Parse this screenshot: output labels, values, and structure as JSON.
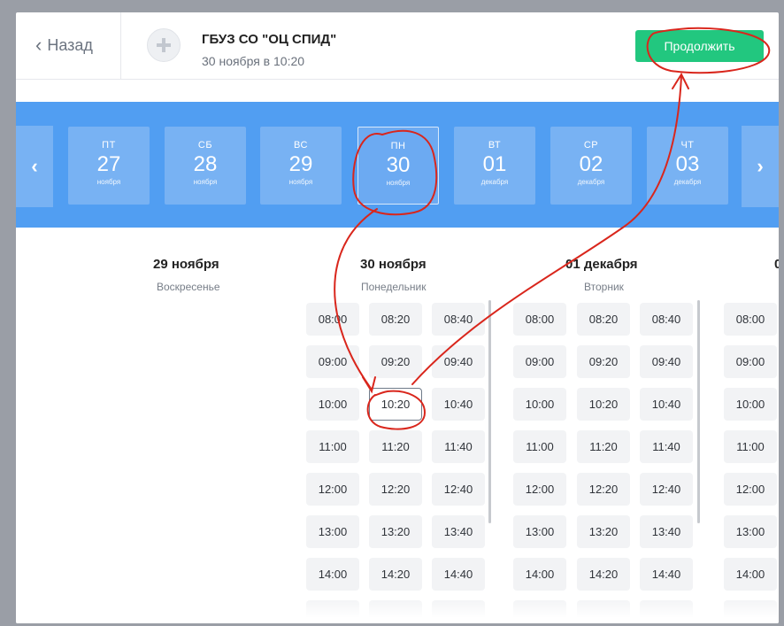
{
  "header": {
    "back_label": "Назад",
    "org_name": "ГБУЗ СО \"ОЦ СПИД\"",
    "appointment": "30 ноября в 10:20",
    "continue_label": "Продолжить"
  },
  "days": [
    {
      "dow": "ПТ",
      "num": "27",
      "month": "ноября"
    },
    {
      "dow": "СБ",
      "num": "28",
      "month": "ноября"
    },
    {
      "dow": "ВС",
      "num": "29",
      "month": "ноября"
    },
    {
      "dow": "ПН",
      "num": "30",
      "month": "ноября",
      "selected": true
    },
    {
      "dow": "ВТ",
      "num": "01",
      "month": "декабря"
    },
    {
      "dow": "СР",
      "num": "02",
      "month": "декабря"
    },
    {
      "dow": "ЧТ",
      "num": "03",
      "month": "декабря"
    }
  ],
  "schedule": [
    {
      "title": "29 ноября",
      "weekday": "Воскресенье",
      "slots": []
    },
    {
      "title": "30 ноября",
      "weekday": "Понедельник",
      "slots": [
        "08:00",
        "08:20",
        "08:40",
        "09:00",
        "09:20",
        "09:40",
        "10:00",
        "10:20",
        "10:40",
        "11:00",
        "11:20",
        "11:40",
        "12:00",
        "12:20",
        "12:40",
        "13:00",
        "13:20",
        "13:40",
        "14:00",
        "14:20",
        "14:40"
      ],
      "selected": "10:20"
    },
    {
      "title": "01 декабря",
      "weekday": "Вторник",
      "slots": [
        "08:00",
        "08:20",
        "08:40",
        "09:00",
        "09:20",
        "09:40",
        "10:00",
        "10:20",
        "10:40",
        "11:00",
        "11:20",
        "11:40",
        "12:00",
        "12:20",
        "12:40",
        "13:00",
        "13:20",
        "13:40",
        "14:00",
        "14:20",
        "14:40"
      ]
    },
    {
      "title": "0",
      "weekday": "",
      "slots": [
        "08:00",
        "09:00",
        "10:00",
        "11:00",
        "12:00",
        "13:00",
        "14:00"
      ]
    }
  ],
  "colors": {
    "accent": "#22c77f",
    "strip": "#519ef2",
    "annotation": "#d9261c"
  }
}
